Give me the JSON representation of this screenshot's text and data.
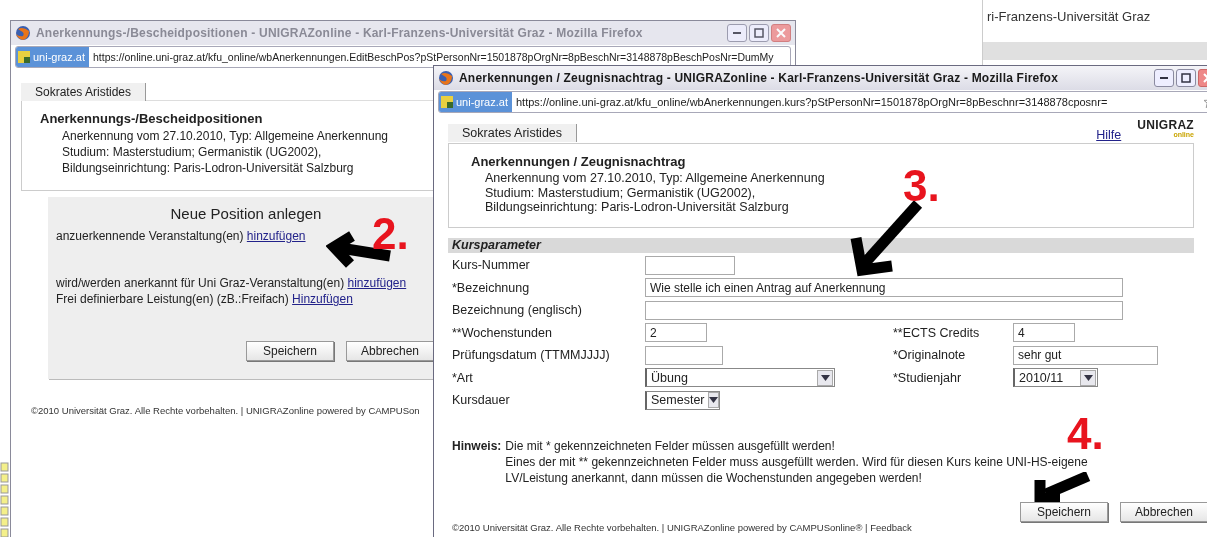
{
  "background_window": {
    "title_fragment": "ri-Franzens-Universität Graz"
  },
  "back_window": {
    "title": "Anerkennungs-/Bescheidpositionen - UNIGRAZonline - Karl-Franzens-Universität Graz - Mozilla Firefox",
    "active": false,
    "site_badge": "uni-graz.at",
    "url": "https://online.uni-graz.at/kfu_online/wbAnerkennungen.EditBeschPos?pStPersonNr=1501878pOrgNr=8pBeschNr=3148878pBeschPosNr=DumMy",
    "tab": "Sokrates Aristides",
    "heading": "Anerkennungs-/Bescheidpositionen",
    "details": [
      "Anerkennung vom 27.10.2010, Typ: Allgemeine Anerkennung",
      "Studium: Masterstudium; Germanistik (UG2002),",
      "Bildungseinrichtung: Paris-Lodron-Universität Salzburg"
    ],
    "panel": {
      "title": "Neue Position anlegen",
      "lines": [
        {
          "text": "anzuerkennende Veranstaltung(en)",
          "link": "hinzufügen"
        },
        {
          "text": "wird/werden anerkannt für Uni Graz-Veranstaltung(en)",
          "link": "hinzufügen"
        },
        {
          "text": "Frei definierbare Leistung(en) (zB.:Freifach)",
          "link": "Hinzufügen"
        }
      ],
      "buttons": [
        "Speichern",
        "Abbrechen"
      ]
    },
    "footer": "©2010 Universität Graz. Alle Rechte vorbehalten. | UNIGRAZonline powered by CAMPUSon"
  },
  "front_window": {
    "title": "Anerkennungen / Zeugnisnachtrag - UNIGRAZonline - Karl-Franzens-Universität Graz - Mozilla Firefox",
    "active": true,
    "site_badge": "uni-graz.at",
    "url": "https://online.uni-graz.at/kfu_online/wbAnerkennungen.kurs?pStPersonNr=1501878pOrgNr=8pBeschnr=3148878cposnr=",
    "tab": "Sokrates Aristides",
    "help_link": "Hilfe",
    "logo": {
      "name": "UNIGRAZ",
      "sub": "online"
    },
    "heading": "Anerkennungen / Zeugnisnachtrag",
    "details": [
      "Anerkennung vom 27.10.2010, Typ: Allgemeine Anerkennung",
      "Studium: Masterstudium; Germanistik (UG2002),",
      "Bildungseinrichtung: Paris-Lodron-Universität Salzburg"
    ],
    "section": "Kursparameter",
    "rows": [
      {
        "left": {
          "label": "Kurs-Nummer",
          "kind": "text"
        }
      },
      {
        "left": {
          "label": "*Bezeichnung",
          "kind": "text",
          "value": "Wie stelle ich einen Antrag auf Anerkennung"
        }
      },
      {
        "left": {
          "label": "Bezeichnung (englisch)",
          "kind": "text"
        }
      },
      {
        "left": {
          "label": "**Wochenstunden",
          "kind": "text",
          "value": "2"
        },
        "right": {
          "label": "**ECTS Credits",
          "kind": "text",
          "value": "4"
        }
      },
      {
        "left": {
          "label": "Prüfungsdatum (TTMMJJJJ)",
          "kind": "text"
        },
        "right": {
          "label": "*Originalnote",
          "kind": "text",
          "value": "sehr gut"
        }
      },
      {
        "left": {
          "label": "*Art",
          "kind": "select",
          "value": "Übung"
        },
        "right": {
          "label": "*Studienjahr",
          "kind": "select",
          "value": "2010/11"
        }
      },
      {
        "left": {
          "label": "Kursdauer",
          "kind": "select",
          "value": "Semester"
        }
      }
    ],
    "note": {
      "label": "Hinweis:",
      "lines": [
        "Die mit * gekennzeichneten Felder müssen ausgefüllt werden!",
        "Eines der mit ** gekennzeichneten Felder muss ausgefüllt werden. Wird für diesen Kurs keine UNI-HS-eigene LV/Leistung anerkannt, dann müssen die Wochenstunden angegeben werden!"
      ]
    },
    "buttons": [
      "Speichern",
      "Abbrechen"
    ],
    "footer": "©2010 Universität Graz. Alle Rechte vorbehalten. | UNIGRAZonline powered by CAMPUSonline® | Feedback"
  },
  "annotations": [
    {
      "label": "2."
    },
    {
      "label": "3."
    },
    {
      "label": "4."
    }
  ]
}
